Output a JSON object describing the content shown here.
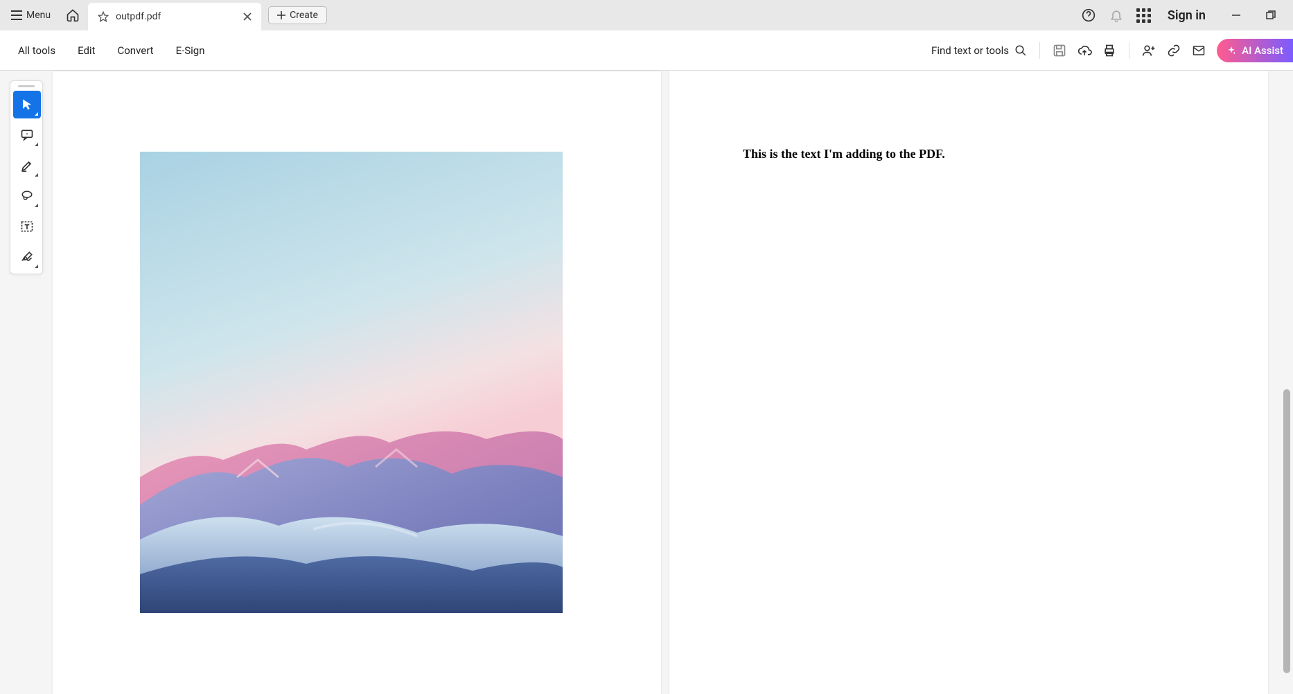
{
  "titlebar": {
    "menu_label": "Menu",
    "tab_title": "outpdf.pdf",
    "create_label": "Create",
    "signin_label": "Sign in"
  },
  "toolbar": {
    "items": [
      "All tools",
      "Edit",
      "Convert",
      "E-Sign"
    ],
    "find_label": "Find text or tools",
    "ai_label": "AI Assist"
  },
  "palette": {
    "tools": [
      "select",
      "comment",
      "highlight",
      "draw",
      "text-box",
      "sign"
    ]
  },
  "document": {
    "page2_text": "This is the text I'm adding to the PDF."
  }
}
